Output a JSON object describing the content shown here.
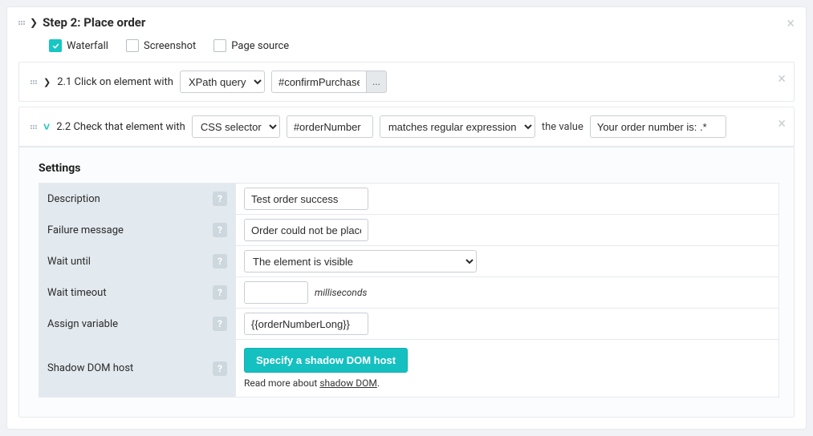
{
  "step": {
    "title": "Step 2: Place order",
    "options": {
      "waterfall": {
        "label": "Waterfall",
        "checked": true
      },
      "screenshot": {
        "label": "Screenshot",
        "checked": false
      },
      "pagesource": {
        "label": "Page source",
        "checked": false
      }
    }
  },
  "sub1": {
    "num": "2.1",
    "prefix": "Click on element with",
    "selectorType": "XPath query",
    "selector": "#confirmPurchase",
    "dots": "..."
  },
  "sub2": {
    "num": "2.2",
    "prefix": "Check that element with",
    "selectorType": "CSS selector",
    "selector": "#orderNumber",
    "matchType": "matches regular expression",
    "valueLabel": "the value",
    "value": "Your order number is: .*"
  },
  "settings": {
    "title": "Settings",
    "rows": {
      "description": {
        "label": "Description",
        "value": "Test order success"
      },
      "failure": {
        "label": "Failure message",
        "value": "Order could not be placed"
      },
      "wait": {
        "label": "Wait until",
        "value": "The element is visible"
      },
      "timeout": {
        "label": "Wait timeout",
        "value": "",
        "hint": "milliseconds"
      },
      "assign": {
        "label": "Assign variable",
        "value": "{{orderNumberLong}}"
      },
      "shadow": {
        "label": "Shadow DOM host",
        "button": "Specify a shadow DOM host",
        "readmore_pre": "Read more about ",
        "readmore_link": "shadow DOM",
        "readmore_post": "."
      }
    }
  },
  "icons": {
    "close": "×",
    "question": "?",
    "chev_right": "❯",
    "chev_down": "˅"
  }
}
